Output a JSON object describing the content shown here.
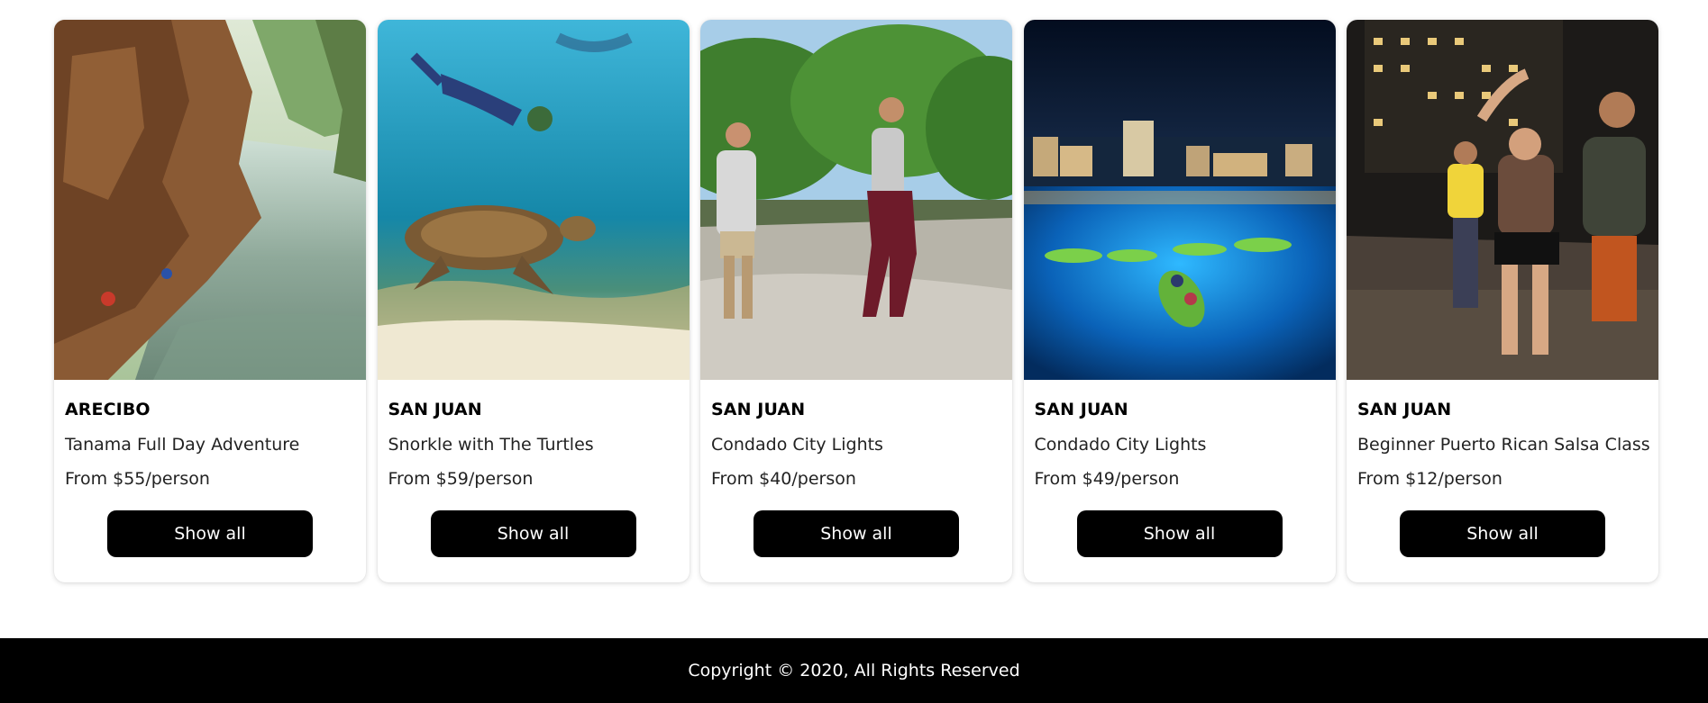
{
  "tours": [
    {
      "city": "ARECIBO",
      "title": "Tanama Full Day Adventure",
      "price": "From $55/person",
      "button": "Show all",
      "photo": "canyon-river-photo"
    },
    {
      "city": "SAN JUAN",
      "title": "Snorkle with The Turtles",
      "price": "From $59/person",
      "button": "Show all",
      "photo": "snorkel-turtle-photo"
    },
    {
      "city": "SAN JUAN",
      "title": "Condado City Lights",
      "price": "From $40/person",
      "button": "Show all",
      "photo": "hikers-photo"
    },
    {
      "city": "SAN JUAN",
      "title": "Condado City Lights",
      "price": "From $49/person",
      "button": "Show all",
      "photo": "night-kayak-photo"
    },
    {
      "city": "SAN JUAN",
      "title": "Beginner Puerto Rican Salsa Class",
      "price": "From $12/person",
      "button": "Show all",
      "photo": "salsa-dancers-photo"
    }
  ],
  "footer": {
    "copyright": "Copyright © 2020, All Rights Reserved"
  },
  "colors": {
    "button_bg": "#000000",
    "button_text": "#ffffff",
    "footer_bg": "#000000"
  }
}
